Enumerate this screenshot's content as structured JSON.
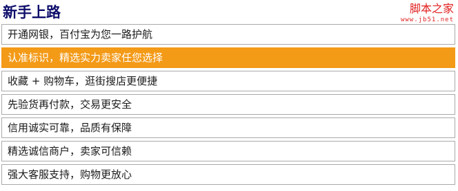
{
  "header": {
    "title": "新手上路"
  },
  "watermark": {
    "name": "脚本之家",
    "url": "www.jb51.net"
  },
  "items": [
    {
      "label": "开通网银，百付宝为您一路护航",
      "active": false
    },
    {
      "label": "认准标识，精选实力卖家任您选择",
      "active": true
    },
    {
      "label": "收藏 + 购物车，逛街搜店更便捷",
      "active": false
    },
    {
      "label": "先验货再付款，交易更安全",
      "active": false
    },
    {
      "label": "信用诚实可靠，品质有保障",
      "active": false
    },
    {
      "label": "精选诚信商户，卖家可信赖",
      "active": false
    },
    {
      "label": "强大客服支持，购物更放心",
      "active": false
    }
  ],
  "colors": {
    "active_background": "#f39a17",
    "title": "#0d0d6b",
    "watermark": "#e02020",
    "border": "#a9a9a9"
  }
}
